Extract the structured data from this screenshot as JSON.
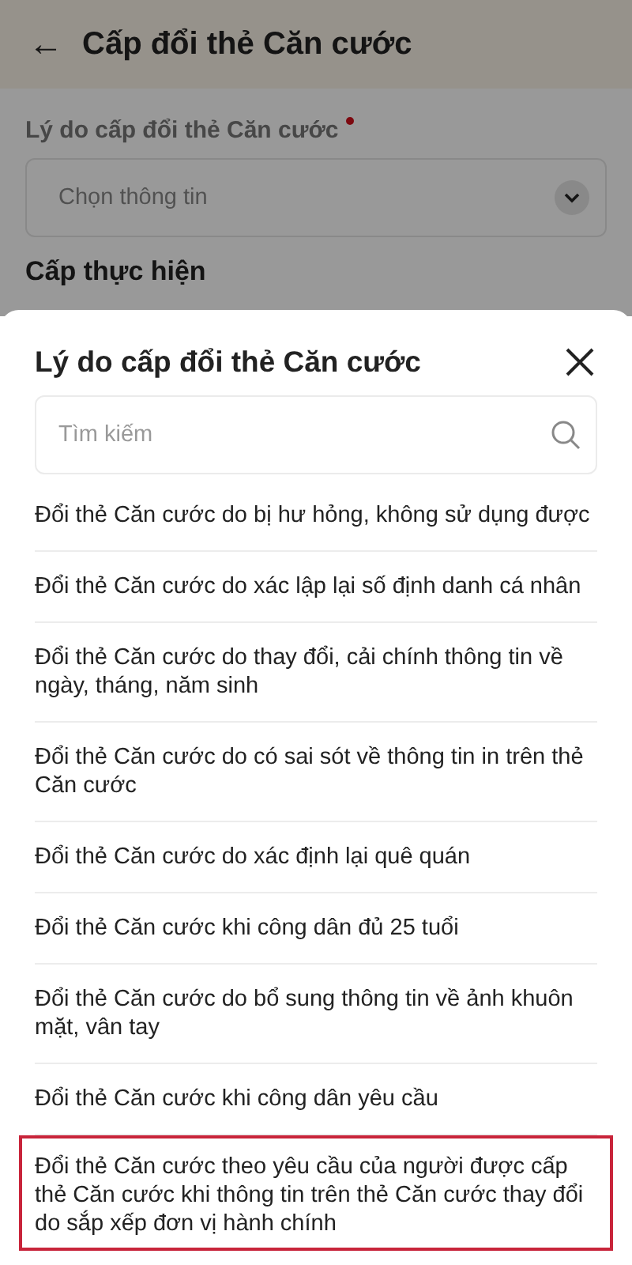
{
  "header": {
    "back_icon_label": "←",
    "title": "Cấp đổi thẻ Căn cước"
  },
  "form": {
    "reason_label": "Lý do cấp đổi thẻ Căn cước",
    "required": true,
    "reason_select": {
      "placeholder": "Chọn thông tin"
    },
    "level_label": "Cấp thực hiện"
  },
  "sheet": {
    "title": "Lý do cấp đổi thẻ Căn cước",
    "search": {
      "placeholder": "Tìm kiếm"
    },
    "items": [
      {
        "label": "Đổi thẻ Căn cước do bị hư hỏng, không sử dụng được",
        "highlighted": false
      },
      {
        "label": "Đổi thẻ Căn cước do xác lập lại số định danh cá nhân",
        "highlighted": false
      },
      {
        "label": "Đổi thẻ Căn cước do thay đổi, cải chính thông tin về ngày, tháng, năm sinh",
        "highlighted": false
      },
      {
        "label": "Đổi thẻ Căn cước do có sai sót về thông tin in trên thẻ Căn cước",
        "highlighted": false
      },
      {
        "label": "Đổi thẻ Căn cước do xác định lại quê quán",
        "highlighted": false
      },
      {
        "label": "Đổi thẻ Căn cước khi công dân đủ 25 tuổi",
        "highlighted": false
      },
      {
        "label": "Đổi thẻ Căn cước do bổ sung thông tin về ảnh khuôn mặt, vân tay",
        "highlighted": false
      },
      {
        "label": "Đổi thẻ Căn cước khi công dân yêu cầu",
        "highlighted": false
      },
      {
        "label": "Đổi thẻ Căn cước theo yêu cầu của người được cấp thẻ Căn cước khi thông tin trên thẻ Căn cước thay đổi do sắp xếp đơn vị hành chính",
        "highlighted": true
      }
    ]
  }
}
